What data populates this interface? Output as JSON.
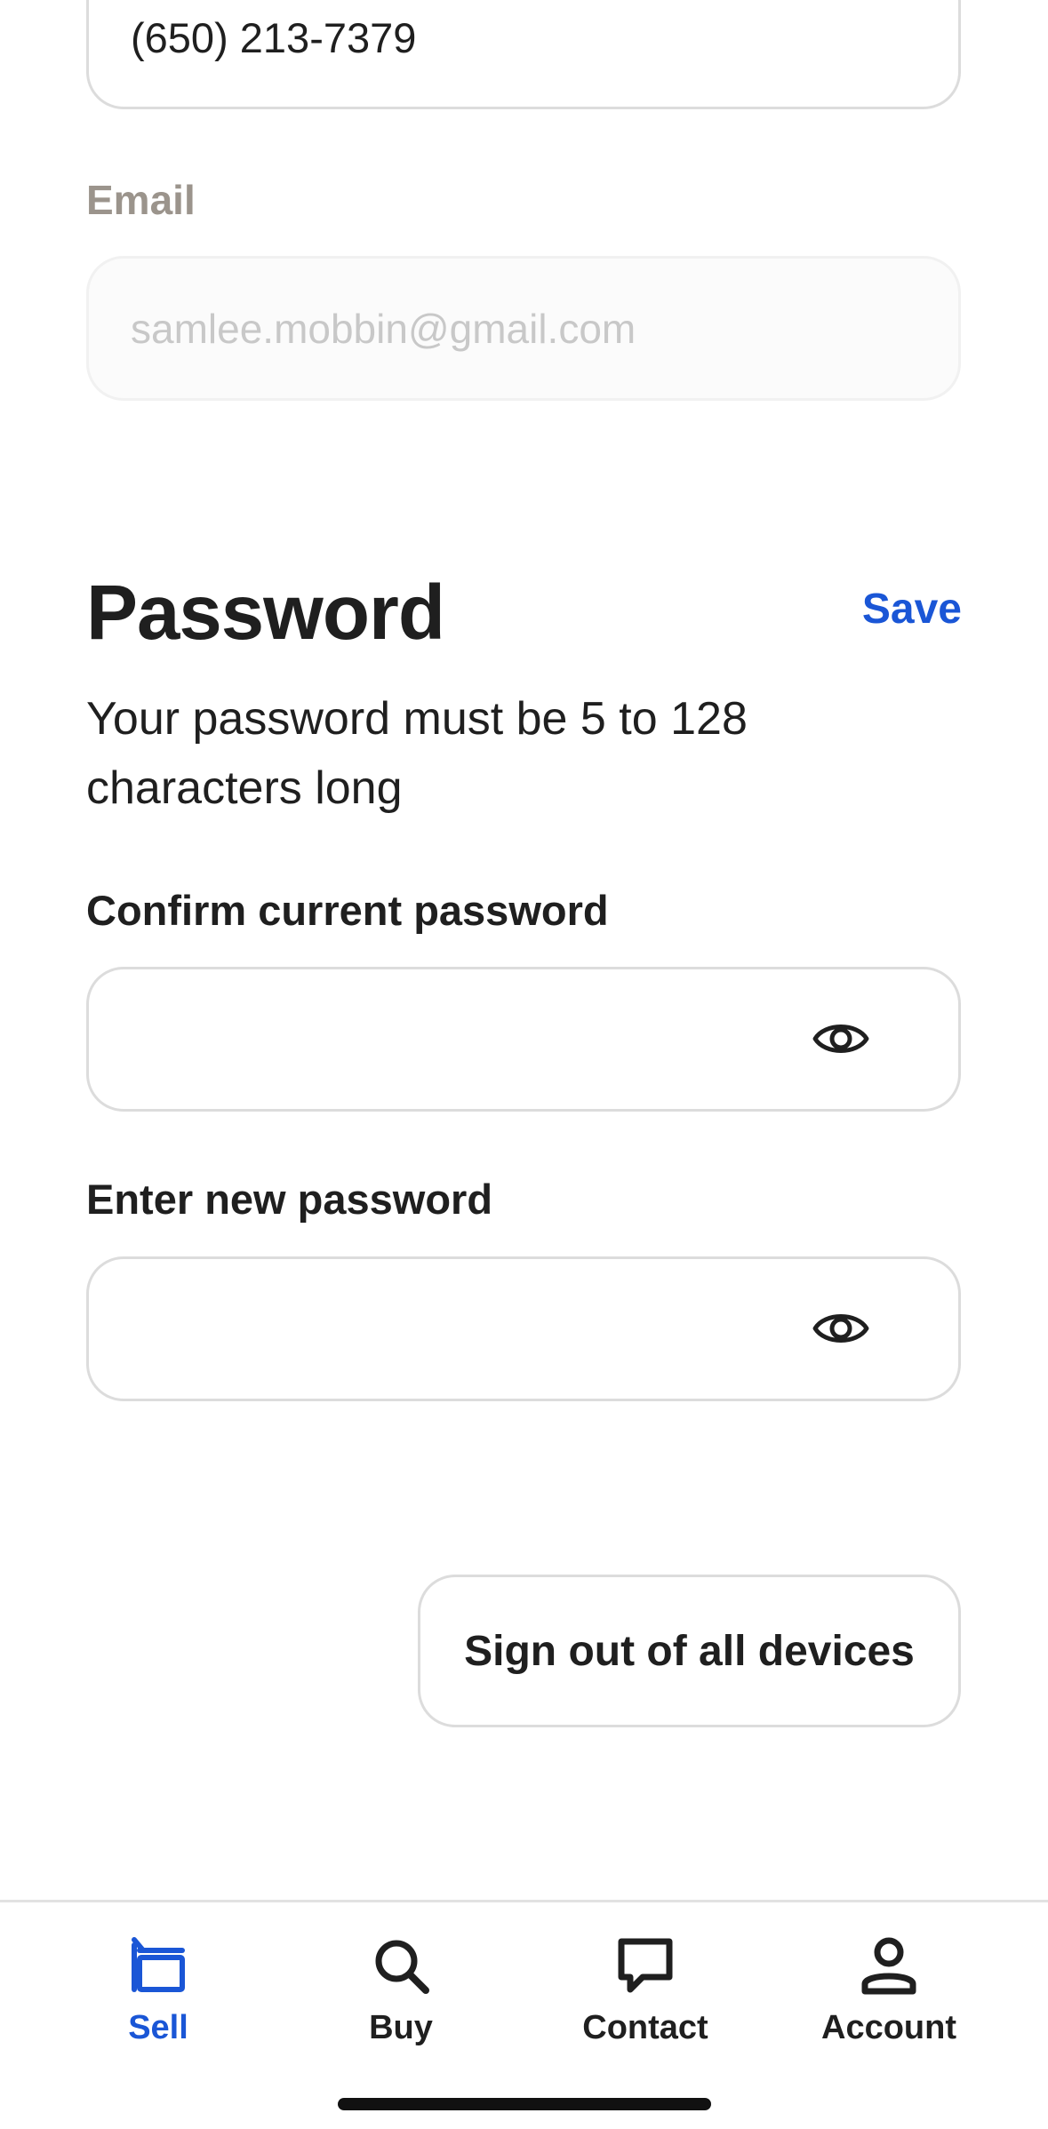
{
  "contact": {
    "phone_value": "(650) 213-7379",
    "email_label": "Email",
    "email_placeholder": "samlee.mobbin@gmail.com"
  },
  "password_section": {
    "title": "Password",
    "save_label": "Save",
    "hint": "Your password must be 5 to 128 characters long",
    "confirm_label": "Confirm current password",
    "new_label": "Enter new password",
    "show_password_icon": "eye-icon"
  },
  "sign_out_label": "Sign out of all devices",
  "tab_bar": {
    "active_color": "#1a56d6",
    "tabs": [
      {
        "label": "Sell",
        "icon": "sell-icon",
        "active": true
      },
      {
        "label": "Buy",
        "icon": "search-icon",
        "active": false
      },
      {
        "label": "Contact",
        "icon": "chat-bubble-icon",
        "active": false
      },
      {
        "label": "Account",
        "icon": "person-icon",
        "active": false
      }
    ]
  }
}
